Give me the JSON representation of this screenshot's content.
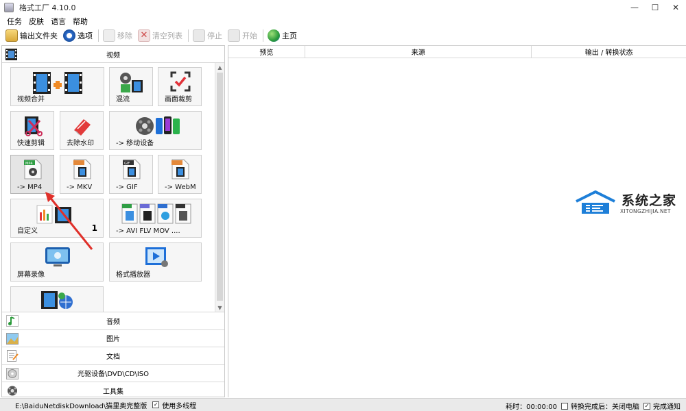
{
  "window": {
    "title": "格式工厂 4.10.0",
    "controls": [
      "—",
      "☐",
      "✕"
    ]
  },
  "menu": {
    "items": [
      "任务",
      "皮肤",
      "语言",
      "帮助"
    ]
  },
  "toolbar": {
    "output_folder": "输出文件夹",
    "options": "选项",
    "remove": "移除",
    "clear_list": "清空列表",
    "stop": "停止",
    "start": "开始",
    "home": "主页"
  },
  "left": {
    "video_header": "视频",
    "tiles": [
      {
        "label": "视频合并",
        "icon": "film-merge-icon"
      },
      {
        "label": "混流",
        "icon": "mux-icon"
      },
      {
        "label": "画面裁剪",
        "icon": "crop-icon"
      },
      {
        "label": "快速剪辑",
        "icon": "quick-clip-icon"
      },
      {
        "label": "去除水印",
        "icon": "eraser-icon"
      },
      {
        "label": "-> 移动设备",
        "icon": "mobile-device-icon"
      },
      {
        "label": "-> MP4",
        "icon": "mp4-file-icon"
      },
      {
        "label": "-> MKV",
        "icon": "mkv-file-icon"
      },
      {
        "label": "-> GIF",
        "icon": "gif-file-icon"
      },
      {
        "label": "-> WebM",
        "icon": "webm-file-icon"
      },
      {
        "label": "自定义",
        "icon": "custom-icon",
        "count": "1"
      },
      {
        "label": "-> AVI FLV MOV ....",
        "icon": "multi-format-icon"
      },
      {
        "label": "屏幕录像",
        "icon": "screen-record-icon"
      },
      {
        "label": "格式播放器",
        "icon": "player-icon"
      },
      {
        "label": "",
        "icon": "film-globe-icon"
      }
    ],
    "categories": [
      {
        "label": "音频",
        "icon": "music-note-icon"
      },
      {
        "label": "图片",
        "icon": "picture-icon"
      },
      {
        "label": "文档",
        "icon": "document-icon"
      },
      {
        "label": "光驱设备\\DVD\\CD\\ISO",
        "icon": "disc-icon"
      },
      {
        "label": "工具集",
        "icon": "tools-icon"
      }
    ]
  },
  "right": {
    "columns": [
      "预览",
      "来源",
      "输出 / 转换状态"
    ]
  },
  "watermark": {
    "title": "系统之家",
    "subtitle": "XITONGZHIJIA.NET"
  },
  "status": {
    "path": "E:\\BaiduNetdiskDownload\\猫里奥完整版",
    "multithread": "使用多线程",
    "elapsed": "耗时：00:00:00",
    "after_convert": "转换完成后：关闭电脑",
    "notify": "完成通知"
  }
}
